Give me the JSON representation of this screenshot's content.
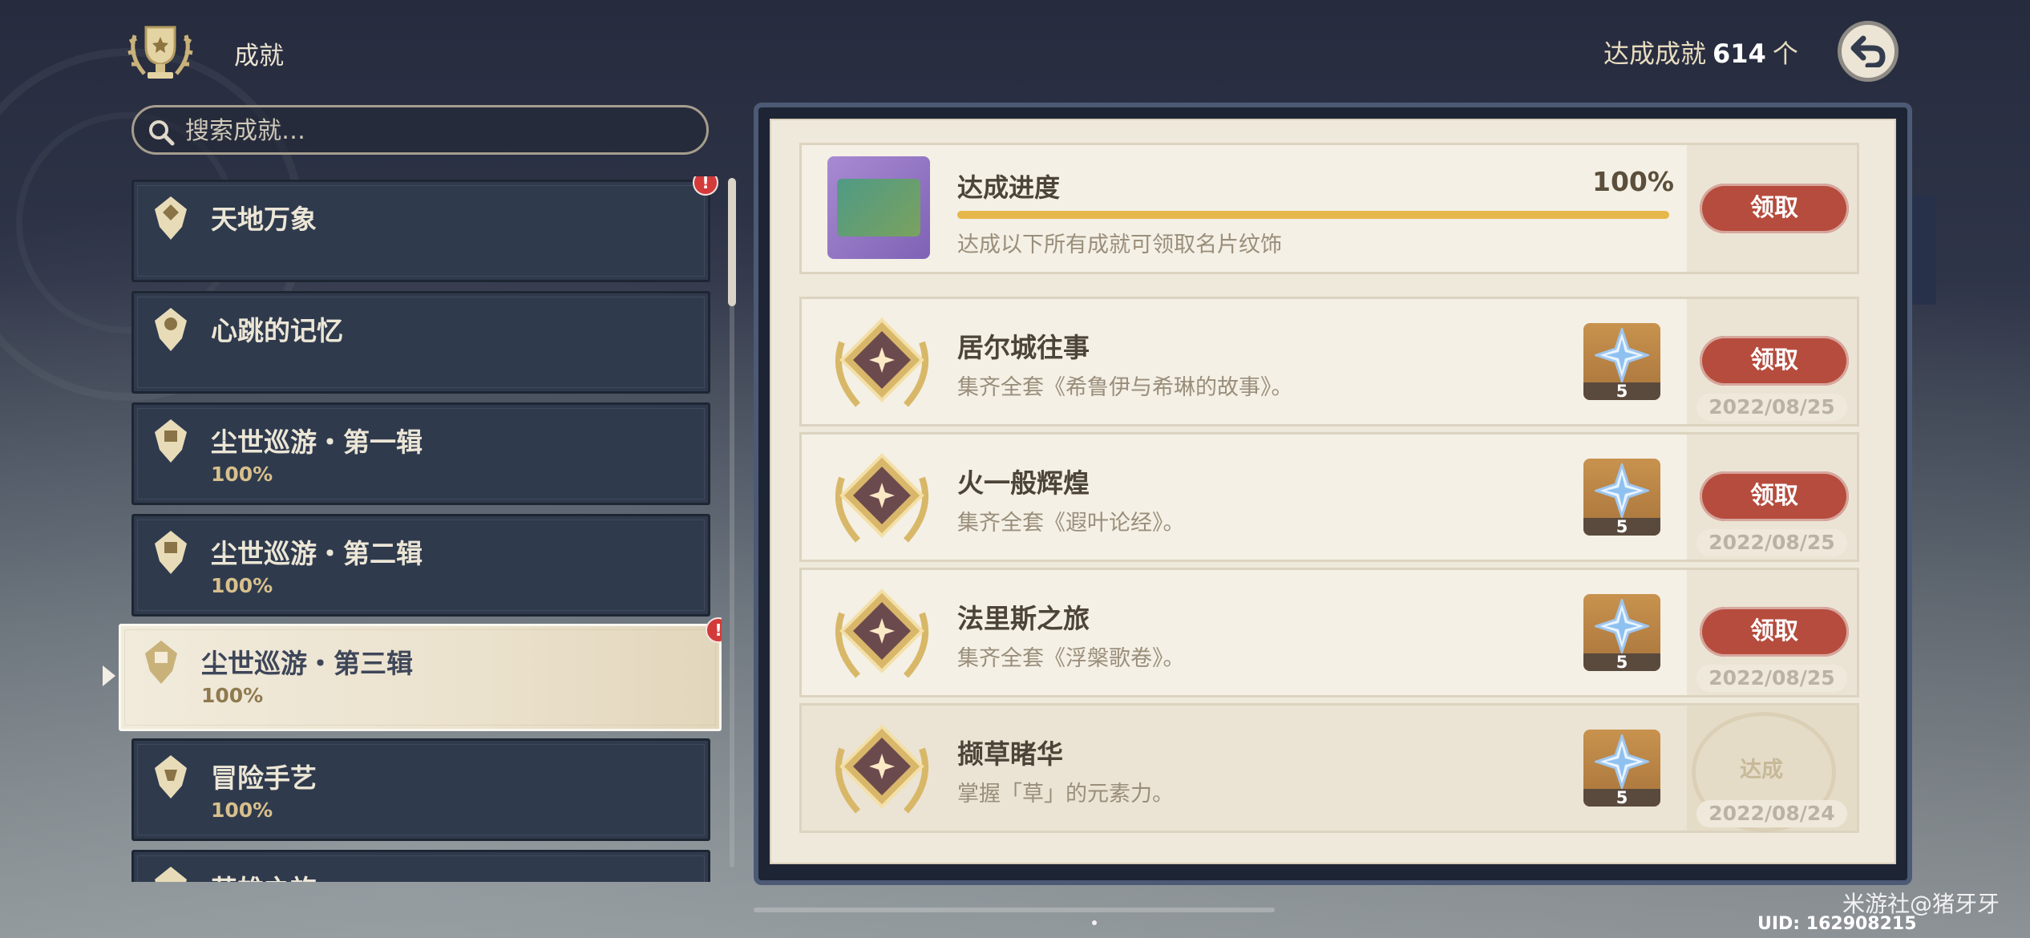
{
  "header": {
    "title": "成就",
    "total_label": "达成成就",
    "total_count": "614",
    "total_unit": "个",
    "back_icon": "back-arrow-icon"
  },
  "search": {
    "placeholder": "搜索成就…",
    "value": ""
  },
  "categories": [
    {
      "name": "天地万象",
      "percent": "",
      "alert": "!"
    },
    {
      "name": "心跳的记忆",
      "percent": ""
    },
    {
      "name": "尘世巡游・第一辑",
      "percent": "100%"
    },
    {
      "name": "尘世巡游・第二辑",
      "percent": "100%"
    },
    {
      "name": "尘世巡游・第三辑",
      "percent": "100%",
      "alert": "!",
      "selected": true
    },
    {
      "name": "冒险手艺",
      "percent": "100%"
    },
    {
      "name": "英雄之旅",
      "percent": ""
    }
  ],
  "progress": {
    "title": "达成进度",
    "percent_text": "100%",
    "value": 1.0,
    "desc": "达成以下所有成就可领取名片纹饰",
    "button": "领取"
  },
  "achievements": [
    {
      "title": "居尔城往事",
      "desc": "集齐全套《希鲁伊与希琳的故事》。",
      "reward_qty": "5",
      "button": "领取",
      "date": "2022/08/25"
    },
    {
      "title": "火一般辉煌",
      "desc": "集齐全套《遐叶论经》。",
      "reward_qty": "5",
      "button": "领取",
      "date": "2022/08/25"
    },
    {
      "title": "法里斯之旅",
      "desc": "集齐全套《浮槃歌卷》。",
      "reward_qty": "5",
      "button": "领取",
      "date": "2022/08/25"
    },
    {
      "title": "撷草睹华",
      "desc": "掌握「草」的元素力。",
      "reward_qty": "5",
      "status": "达成",
      "date": "2022/08/24"
    }
  ],
  "footer": {
    "watermark": "米游社@猪牙牙",
    "uid": "UID: 162908215"
  },
  "colors": {
    "claim_button": "#b64c3d",
    "progress_fill": "#e6b74a",
    "selected_category": "#f1ebdc"
  }
}
